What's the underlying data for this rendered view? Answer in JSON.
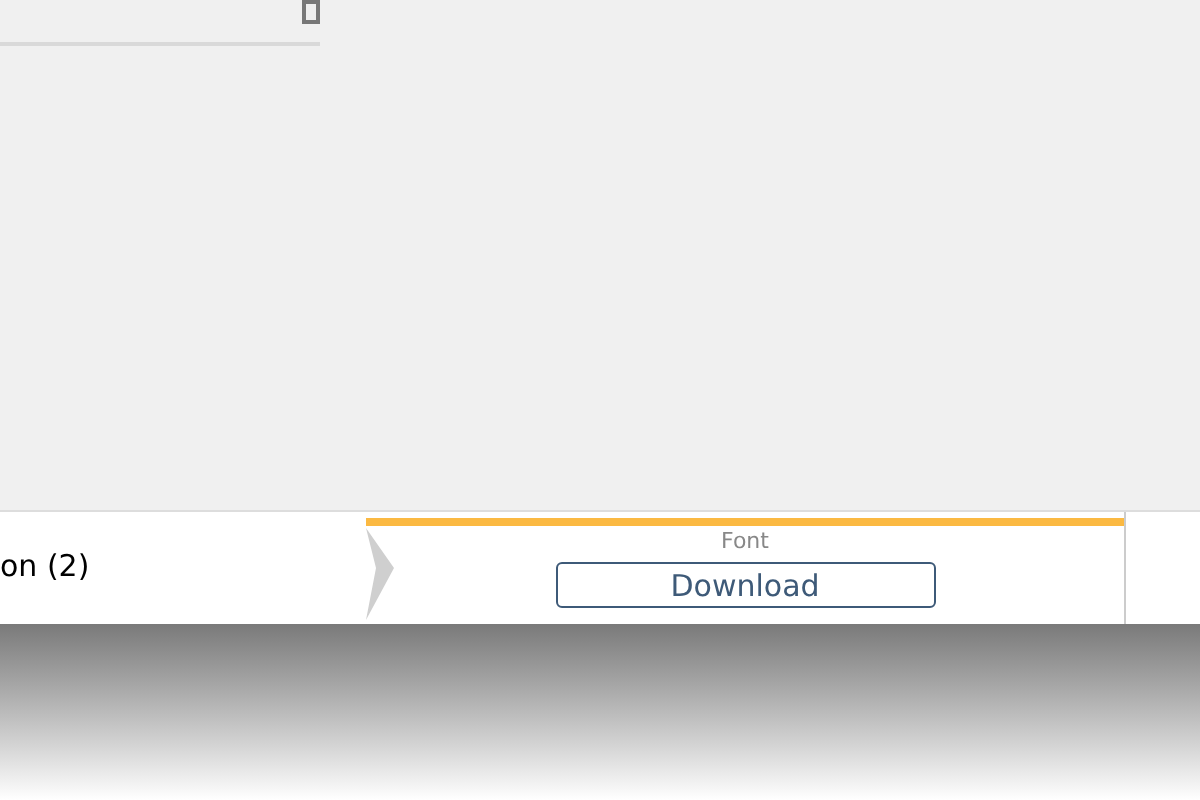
{
  "steps": [
    {
      "label": "on (2)",
      "selected": false
    },
    {
      "label": "Font",
      "selected": true,
      "button": "Download"
    }
  ]
}
